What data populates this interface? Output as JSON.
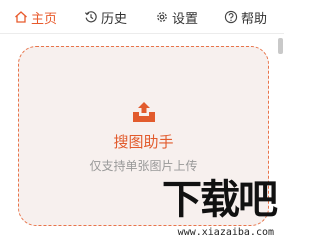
{
  "toolbar": {
    "tabs": [
      {
        "label": "主页",
        "icon": "home-icon",
        "active": true
      },
      {
        "label": "历史",
        "icon": "history-icon",
        "active": false
      },
      {
        "label": "设置",
        "icon": "gear-icon",
        "active": false
      },
      {
        "label": "帮助",
        "icon": "help-icon",
        "active": false
      }
    ]
  },
  "drop_zone": {
    "icon": "upload-icon",
    "title": "搜图助手",
    "subtitle": "仅支持单张图片上传"
  },
  "watermark": {
    "logo_text": "下载吧",
    "url": "www.xiazaiba.com"
  },
  "colors": {
    "accent": "#e25b2d",
    "zone_background": "#f7f0ee",
    "zone_border": "#e8744a"
  }
}
